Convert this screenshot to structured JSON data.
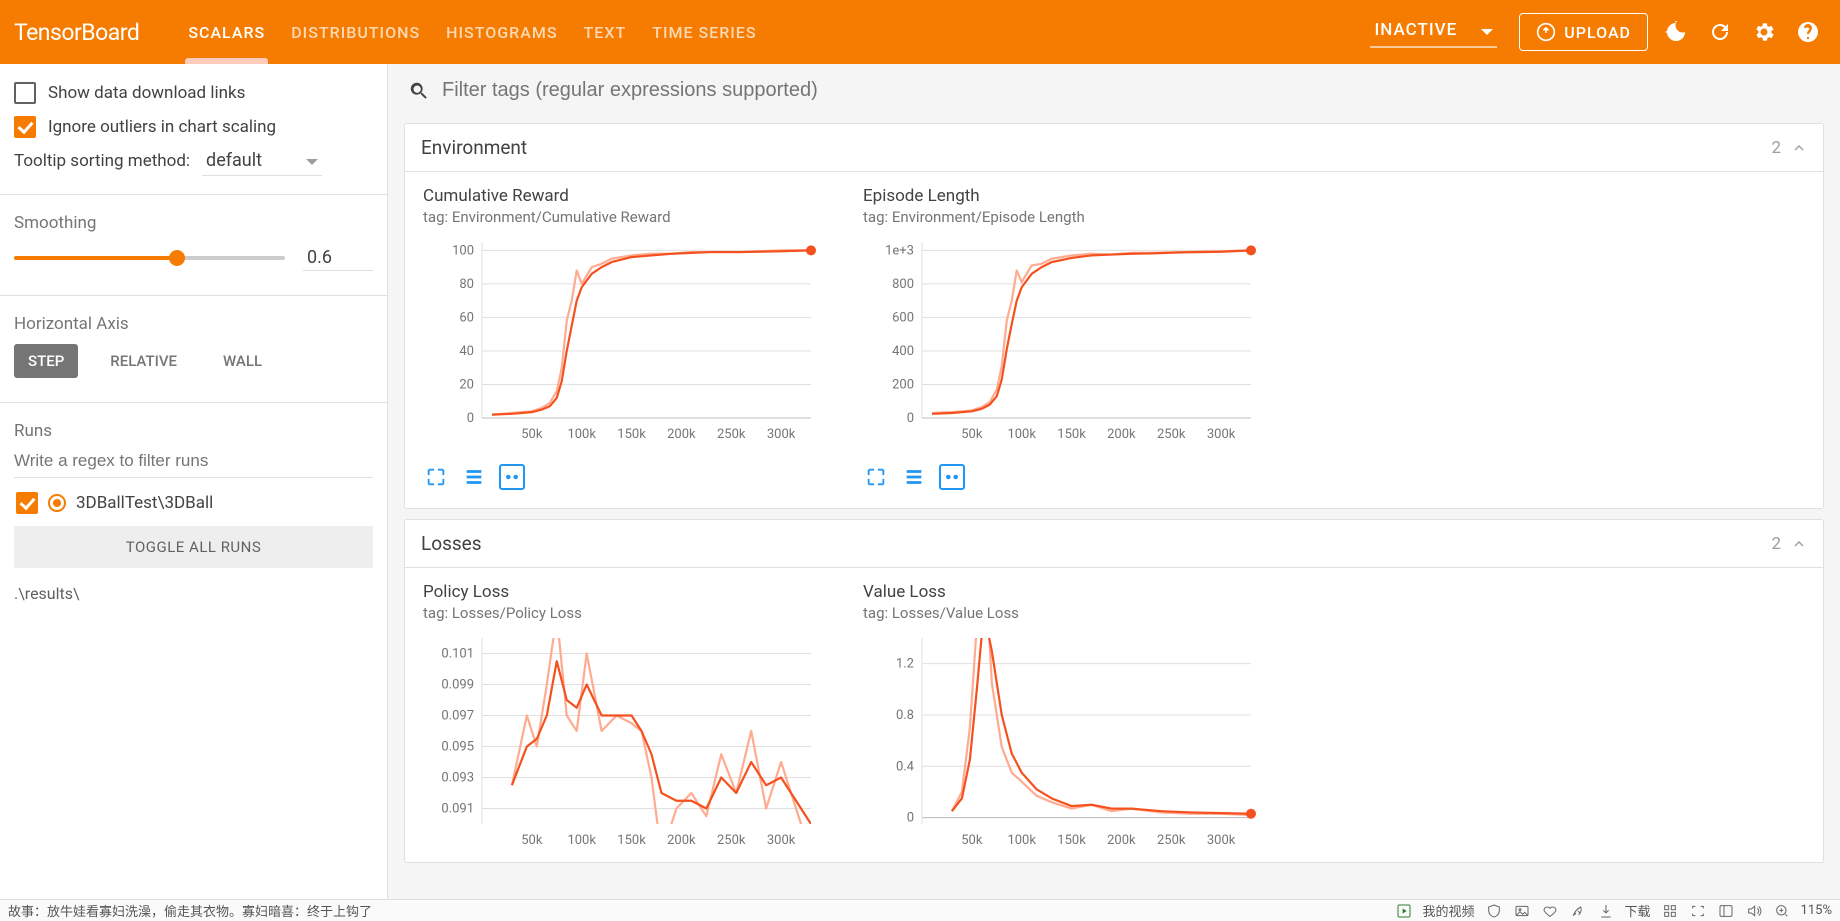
{
  "header": {
    "logo": "TensorBoard",
    "tabs": [
      "SCALARS",
      "DISTRIBUTIONS",
      "HISTOGRAMS",
      "TEXT",
      "TIME SERIES"
    ],
    "active_tab": 0,
    "status_label": "INACTIVE",
    "upload_label": "UPLOAD"
  },
  "sidebar": {
    "show_download_label": "Show data download links",
    "show_download_checked": false,
    "ignore_outliers_label": "Ignore outliers in chart scaling",
    "ignore_outliers_checked": true,
    "tooltip_sort_label": "Tooltip sorting method:",
    "tooltip_sort_value": "default",
    "smoothing_label": "Smoothing",
    "smoothing_value": "0.6",
    "haxis_label": "Horizontal Axis",
    "haxis_options": [
      "STEP",
      "RELATIVE",
      "WALL"
    ],
    "haxis_active": 0,
    "runs_label": "Runs",
    "runs_filter_placeholder": "Write a regex to filter runs",
    "run_name": "3DBallTest\\3DBall",
    "toggle_all_label": "TOGGLE ALL RUNS",
    "results_path": ".\\results\\"
  },
  "main": {
    "filter_placeholder": "Filter tags (regular expressions supported)",
    "sections": [
      {
        "title": "Environment",
        "count": "2",
        "plots": [
          {
            "title": "Cumulative Reward",
            "tag": "tag: Environment/Cumulative Reward"
          },
          {
            "title": "Episode Length",
            "tag": "tag: Environment/Episode Length"
          }
        ]
      },
      {
        "title": "Losses",
        "count": "2",
        "plots": [
          {
            "title": "Policy Loss",
            "tag": "tag: Losses/Policy Loss"
          },
          {
            "title": "Value Loss",
            "tag": "tag: Losses/Value Loss"
          }
        ]
      }
    ]
  },
  "chart_data": [
    {
      "type": "line",
      "title": "Cumulative Reward",
      "xlabel": "",
      "ylabel": "",
      "x_ticks": [
        "50k",
        "100k",
        "150k",
        "200k",
        "250k",
        "300k"
      ],
      "y_ticks": [
        0,
        20,
        40,
        60,
        80,
        100
      ],
      "xlim": [
        0,
        330000
      ],
      "ylim": [
        0,
        105
      ],
      "series": [
        {
          "name": "3DBallTest\\3DBall (raw)",
          "color": "#ffab91",
          "x": [
            10000,
            30000,
            50000,
            60000,
            68000,
            75000,
            80000,
            85000,
            90000,
            95000,
            100000,
            110000,
            120000,
            130000,
            150000,
            170000,
            190000,
            210000,
            230000,
            260000,
            300000,
            330000
          ],
          "y": [
            2,
            3,
            4,
            6,
            9,
            16,
            30,
            58,
            70,
            88,
            80,
            90,
            92,
            95,
            97,
            98,
            98,
            99,
            99,
            99,
            100,
            100
          ]
        },
        {
          "name": "3DBallTest\\3DBall (smoothed)",
          "color": "#f4511e",
          "x": [
            10000,
            30000,
            50000,
            60000,
            68000,
            75000,
            80000,
            85000,
            90000,
            95000,
            100000,
            110000,
            120000,
            130000,
            150000,
            170000,
            190000,
            210000,
            230000,
            260000,
            300000,
            330000
          ],
          "y": [
            2,
            2.5,
            3.5,
            5,
            7,
            12,
            22,
            40,
            55,
            70,
            78,
            86,
            90,
            93,
            96,
            97,
            98,
            98.5,
            99,
            99,
            99.5,
            100
          ]
        }
      ],
      "end_marker": {
        "x": 330000,
        "y": 100
      }
    },
    {
      "type": "line",
      "title": "Episode Length",
      "xlabel": "",
      "ylabel": "",
      "x_ticks": [
        "50k",
        "100k",
        "150k",
        "200k",
        "250k",
        "300k"
      ],
      "y_ticks": [
        0,
        200,
        400,
        600,
        800,
        "1e+3"
      ],
      "xlim": [
        0,
        330000
      ],
      "ylim": [
        0,
        1050
      ],
      "series": [
        {
          "name": "3DBallTest\\3DBall (raw)",
          "color": "#ffab91",
          "x": [
            10000,
            30000,
            50000,
            60000,
            68000,
            75000,
            80000,
            85000,
            90000,
            95000,
            100000,
            110000,
            120000,
            130000,
            150000,
            170000,
            190000,
            210000,
            230000,
            260000,
            300000,
            330000
          ],
          "y": [
            30,
            35,
            45,
            65,
            95,
            170,
            310,
            580,
            700,
            880,
            810,
            910,
            920,
            950,
            970,
            980,
            975,
            985,
            985,
            990,
            995,
            1000
          ]
        },
        {
          "name": "3DBallTest\\3DBall (smoothed)",
          "color": "#f4511e",
          "x": [
            10000,
            30000,
            50000,
            60000,
            68000,
            75000,
            80000,
            85000,
            90000,
            95000,
            100000,
            110000,
            120000,
            130000,
            150000,
            170000,
            190000,
            210000,
            230000,
            260000,
            300000,
            330000
          ],
          "y": [
            25,
            30,
            40,
            55,
            80,
            130,
            230,
            410,
            560,
            700,
            780,
            860,
            900,
            930,
            955,
            970,
            975,
            980,
            982,
            988,
            992,
            1000
          ]
        }
      ],
      "end_marker": {
        "x": 330000,
        "y": 1000
      }
    },
    {
      "type": "line",
      "title": "Policy Loss",
      "xlabel": "",
      "ylabel": "",
      "x_ticks": [
        "50k",
        "100k",
        "150k",
        "200k",
        "250k",
        "300k"
      ],
      "y_ticks": [
        0.091,
        0.093,
        0.095,
        0.097,
        0.099,
        0.101
      ],
      "xlim": [
        0,
        330000
      ],
      "ylim": [
        0.09,
        0.102
      ],
      "series": [
        {
          "name": "3DBallTest\\3DBall (raw)",
          "color": "#ffab91",
          "x": [
            30000,
            45000,
            55000,
            65000,
            75000,
            85000,
            95000,
            105000,
            120000,
            135000,
            150000,
            160000,
            170000,
            180000,
            195000,
            210000,
            225000,
            240000,
            255000,
            270000,
            285000,
            300000,
            315000,
            330000
          ],
          "y": [
            0.0925,
            0.097,
            0.095,
            0.099,
            0.1035,
            0.097,
            0.096,
            0.101,
            0.096,
            0.097,
            0.0965,
            0.096,
            0.093,
            0.088,
            0.091,
            0.092,
            0.0905,
            0.0945,
            0.092,
            0.096,
            0.091,
            0.094,
            0.091,
            0.088
          ]
        },
        {
          "name": "3DBallTest\\3DBall (smoothed)",
          "color": "#f4511e",
          "x": [
            30000,
            45000,
            55000,
            65000,
            75000,
            85000,
            95000,
            105000,
            120000,
            135000,
            150000,
            160000,
            170000,
            180000,
            195000,
            210000,
            225000,
            240000,
            255000,
            270000,
            285000,
            300000,
            315000,
            330000
          ],
          "y": [
            0.0925,
            0.095,
            0.0955,
            0.097,
            0.1005,
            0.098,
            0.0975,
            0.099,
            0.097,
            0.097,
            0.097,
            0.096,
            0.0945,
            0.092,
            0.0915,
            0.0915,
            0.091,
            0.093,
            0.092,
            0.094,
            0.0925,
            0.093,
            0.0915,
            0.09
          ]
        }
      ]
    },
    {
      "type": "line",
      "title": "Value Loss",
      "xlabel": "",
      "ylabel": "",
      "x_ticks": [
        "50k",
        "100k",
        "150k",
        "200k",
        "250k",
        "300k"
      ],
      "y_ticks": [
        0,
        0.4,
        0.8,
        1.2
      ],
      "xlim": [
        0,
        330000
      ],
      "ylim": [
        -0.05,
        1.4
      ],
      "series": [
        {
          "name": "3DBallTest\\3DBall (raw)",
          "color": "#ffab91",
          "x": [
            30000,
            40000,
            48000,
            55000,
            62000,
            70000,
            80000,
            90000,
            100000,
            115000,
            130000,
            150000,
            170000,
            190000,
            210000,
            240000,
            270000,
            300000,
            330000
          ],
          "y": [
            0.05,
            0.2,
            0.7,
            1.5,
            2.2,
            1.05,
            0.55,
            0.35,
            0.28,
            0.17,
            0.12,
            0.07,
            0.1,
            0.05,
            0.07,
            0.04,
            0.03,
            0.03,
            0.02
          ]
        },
        {
          "name": "3DBallTest\\3DBall (smoothed)",
          "color": "#f4511e",
          "x": [
            30000,
            40000,
            48000,
            55000,
            62000,
            70000,
            80000,
            90000,
            100000,
            115000,
            130000,
            150000,
            170000,
            190000,
            210000,
            240000,
            270000,
            300000,
            330000
          ],
          "y": [
            0.05,
            0.15,
            0.45,
            1.0,
            1.6,
            1.3,
            0.8,
            0.5,
            0.35,
            0.22,
            0.15,
            0.09,
            0.1,
            0.07,
            0.07,
            0.05,
            0.04,
            0.035,
            0.03
          ]
        }
      ],
      "end_marker": {
        "x": 330000,
        "y": 0.03
      }
    }
  ],
  "statusbar": {
    "joke": "故事：放牛娃看寡妇洗澡，偷走其衣物。寡妇暗喜：终于上钩了",
    "video": "我的视频",
    "download": "下载",
    "zoom": "115%"
  }
}
